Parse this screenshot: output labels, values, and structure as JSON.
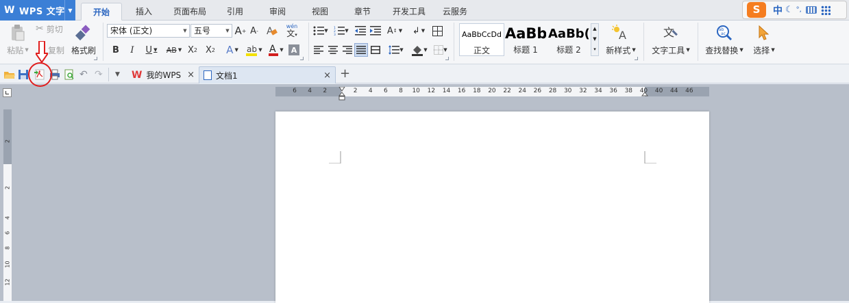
{
  "app": {
    "title": "WPS 文字"
  },
  "menu": {
    "tabs": [
      {
        "label": "开始",
        "active": true
      },
      {
        "label": "插入"
      },
      {
        "label": "页面布局"
      },
      {
        "label": "引用"
      },
      {
        "label": "审阅"
      },
      {
        "label": "视图"
      },
      {
        "label": "章节"
      },
      {
        "label": "开发工具"
      },
      {
        "label": "云服务"
      }
    ]
  },
  "tray": {
    "ime": "S",
    "lang": "中"
  },
  "ribbon": {
    "paste": "粘贴",
    "cut": "剪切",
    "copy": "复制",
    "format_painter": "格式刷",
    "font_name": "宋体 (正文)",
    "font_size": "五号",
    "pinyin": "wén",
    "styles": [
      {
        "sample": "AaBbCcDd",
        "label": "正文"
      },
      {
        "sample": "AaBb",
        "label": "标题 1"
      },
      {
        "sample": "AaBb(",
        "label": "标题 2"
      }
    ],
    "new_style": "新样式",
    "text_tools": "文字工具",
    "find_replace": "查找替换",
    "select": "选择"
  },
  "doc_tabs": [
    {
      "label": "我的WPS"
    },
    {
      "label": "文档1",
      "active": true
    }
  ],
  "ruler": {
    "h_ticks": [
      "6",
      "4",
      "2",
      "2",
      "4",
      "6",
      "8",
      "10",
      "12",
      "14",
      "16",
      "18",
      "20",
      "22",
      "24",
      "26",
      "28",
      "30",
      "32",
      "34",
      "36",
      "38",
      "40",
      "40",
      "44",
      "46"
    ],
    "v_ticks": [
      "2",
      "2",
      "4",
      "6",
      "8",
      "10",
      "12"
    ]
  },
  "colors": {
    "accent": "#3b7fd6",
    "annotation": "#e01e1e",
    "font_color": "#d21e1e",
    "highlight": "#f3e000"
  }
}
